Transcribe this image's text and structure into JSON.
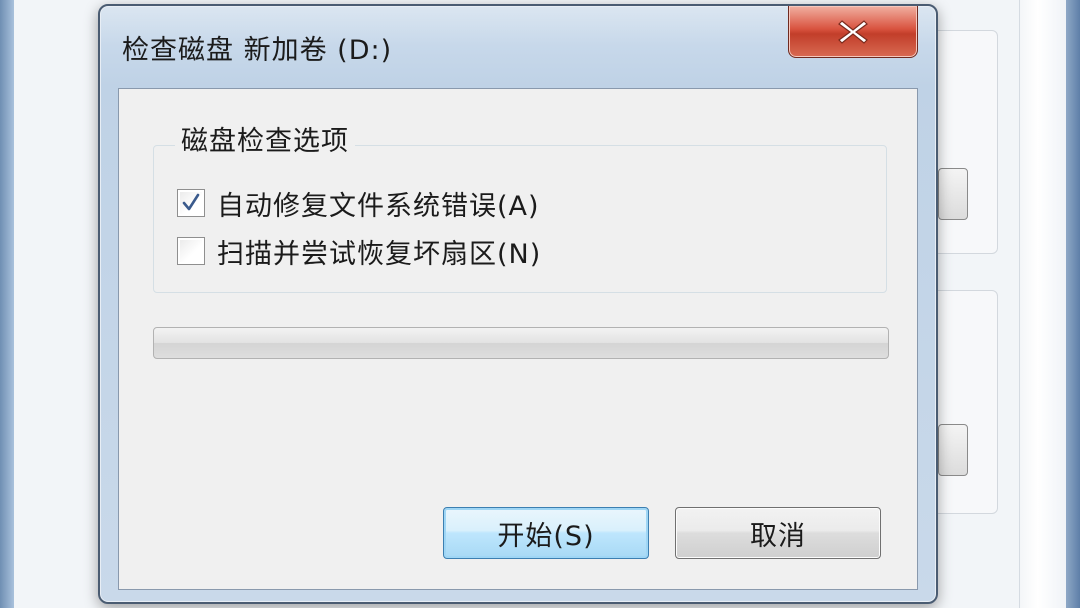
{
  "dialog": {
    "title": "检查磁盘 新加卷 (D:)",
    "close_icon": "close-icon"
  },
  "options_group": {
    "label": "磁盘检查选项",
    "options": [
      {
        "label": "自动修复文件系统错误(A)",
        "checked": true
      },
      {
        "label": "扫描并尝试恢复坏扇区(N)",
        "checked": false
      }
    ]
  },
  "progress": {
    "value": 0
  },
  "buttons": {
    "start_label": "开始(S)",
    "cancel_label": "取消"
  },
  "colors": {
    "close_button": "#c94a35",
    "primary_border": "#3c7fb1",
    "check_mark": "#3a5a8c"
  }
}
